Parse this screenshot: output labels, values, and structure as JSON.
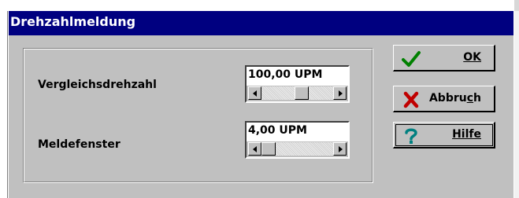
{
  "window": {
    "title": "Drehzahlmeldung"
  },
  "fields": [
    {
      "label": "Vergleichsdrehzahl",
      "value": "100,00 UPM"
    },
    {
      "label": "Meldefenster",
      "value": "4,00 UPM"
    }
  ],
  "buttons": {
    "ok": {
      "label": "OK",
      "icon": "checkmark-icon"
    },
    "cancel": {
      "label_pre": "Abbru",
      "label_mnemonic": "c",
      "label_post": "h",
      "icon": "red-x-icon"
    },
    "help": {
      "label": "Hilfe",
      "icon": "question-icon"
    }
  },
  "colors": {
    "titlebar": "#000080",
    "dialog": "#c0c0c0",
    "check": "#008000",
    "cross": "#c00000",
    "question": "#008080"
  }
}
